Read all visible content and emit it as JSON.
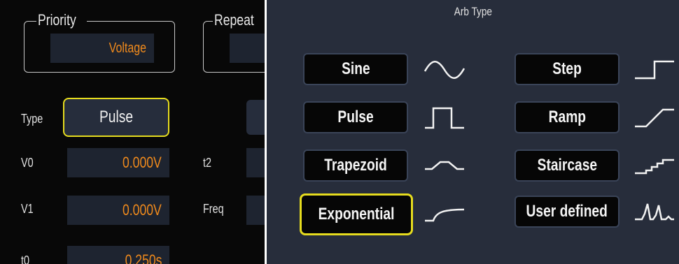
{
  "left_panel": {
    "priority": {
      "title": "Priority",
      "value": "Voltage"
    },
    "repeat": {
      "title": "Repeat"
    },
    "type": {
      "label": "Type",
      "value": "Pulse"
    },
    "params": [
      {
        "label": "V0",
        "value": "0.000V"
      },
      {
        "label": "V1",
        "value": "0.000V"
      },
      {
        "label": "t0",
        "value": "0.250s"
      }
    ],
    "second_column": [
      {
        "label": "t2"
      },
      {
        "label": "Freq"
      }
    ]
  },
  "arb_panel": {
    "title": "Arb Type",
    "selected": "Exponential",
    "options": [
      {
        "label": "Sine",
        "icon": "sine-wave-icon"
      },
      {
        "label": "Pulse",
        "icon": "pulse-wave-icon"
      },
      {
        "label": "Trapezoid",
        "icon": "trapezoid-wave-icon"
      },
      {
        "label": "Exponential",
        "icon": "exponential-wave-icon"
      },
      {
        "label": "Step",
        "icon": "step-wave-icon"
      },
      {
        "label": "Ramp",
        "icon": "ramp-wave-icon"
      },
      {
        "label": "Staircase",
        "icon": "staircase-wave-icon"
      },
      {
        "label": "User defined",
        "icon": "user-defined-wave-icon"
      }
    ]
  },
  "colors": {
    "accent_value": "#f08a1c",
    "selection": "#e6dc1e",
    "arb_background": "#272d3b",
    "left_background": "#080808"
  }
}
